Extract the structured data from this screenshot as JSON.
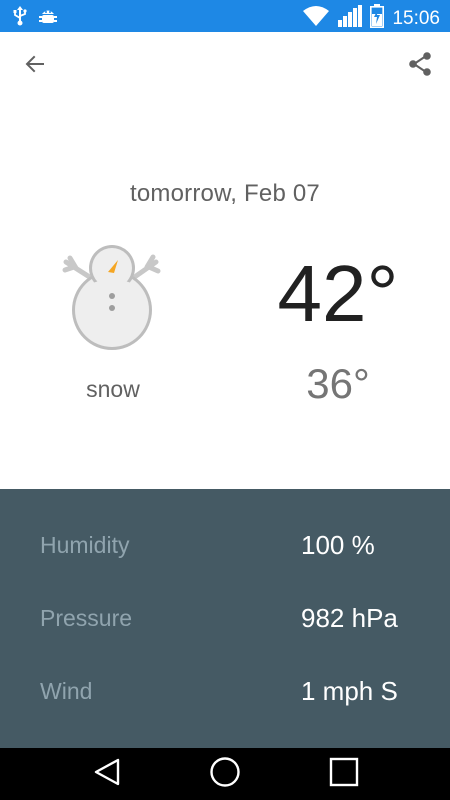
{
  "status_bar": {
    "time": "15:06",
    "icons": [
      "usb-icon",
      "android-debug-icon",
      "wifi-icon",
      "signal-icon",
      "battery-charging-icon"
    ]
  },
  "app_bar": {
    "back_icon": "arrow-back-icon",
    "share_icon": "share-icon"
  },
  "forecast": {
    "date": "tomorrow, Feb 07",
    "condition": "snow",
    "condition_icon": "snowman-icon",
    "high": "42°",
    "low": "36°"
  },
  "details": {
    "humidity": {
      "label": "Humidity",
      "value": "100 %"
    },
    "pressure": {
      "label": "Pressure",
      "value": "982 hPa"
    },
    "wind": {
      "label": "Wind",
      "value": "1 mph S"
    }
  },
  "colors": {
    "status_bar": "#1e88e5",
    "details_panel": "#455a64",
    "detail_label": "#90a4ae"
  },
  "nav_bar": {
    "buttons": [
      "back-triangle-icon",
      "home-circle-icon",
      "recents-square-icon"
    ]
  }
}
